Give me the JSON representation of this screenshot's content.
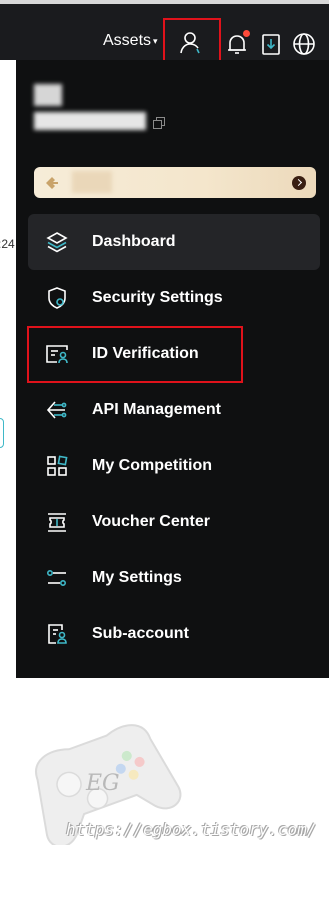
{
  "topbar": {
    "assets_label": "Assets",
    "caret": "▾",
    "icons": [
      "user-icon",
      "bell-icon",
      "download-icon",
      "globe-icon"
    ],
    "notification_dot_color": "#ff4b3a"
  },
  "background": {
    "partial_text": ":24"
  },
  "menu": {
    "items": [
      {
        "label": "Dashboard",
        "icon": "layers-icon",
        "active": true
      },
      {
        "label": "Security Settings",
        "icon": "shield-icon",
        "active": false
      },
      {
        "label": "ID Verification",
        "icon": "id-card-icon",
        "active": false
      },
      {
        "label": "API Management",
        "icon": "api-icon",
        "active": false
      },
      {
        "label": "My Competition",
        "icon": "grid-icon",
        "active": false
      },
      {
        "label": "Voucher Center",
        "icon": "voucher-icon",
        "active": false
      },
      {
        "label": "My Settings",
        "icon": "sliders-icon",
        "active": false
      },
      {
        "label": "Sub-account",
        "icon": "sub-account-icon",
        "active": false
      }
    ]
  },
  "colors": {
    "panel_bg": "#0f1011",
    "accent_teal": "#3fb8c8",
    "highlight_red": "#e0121b"
  },
  "watermark": {
    "brand": "EG",
    "url": "https://egbox.tistory.com/"
  }
}
